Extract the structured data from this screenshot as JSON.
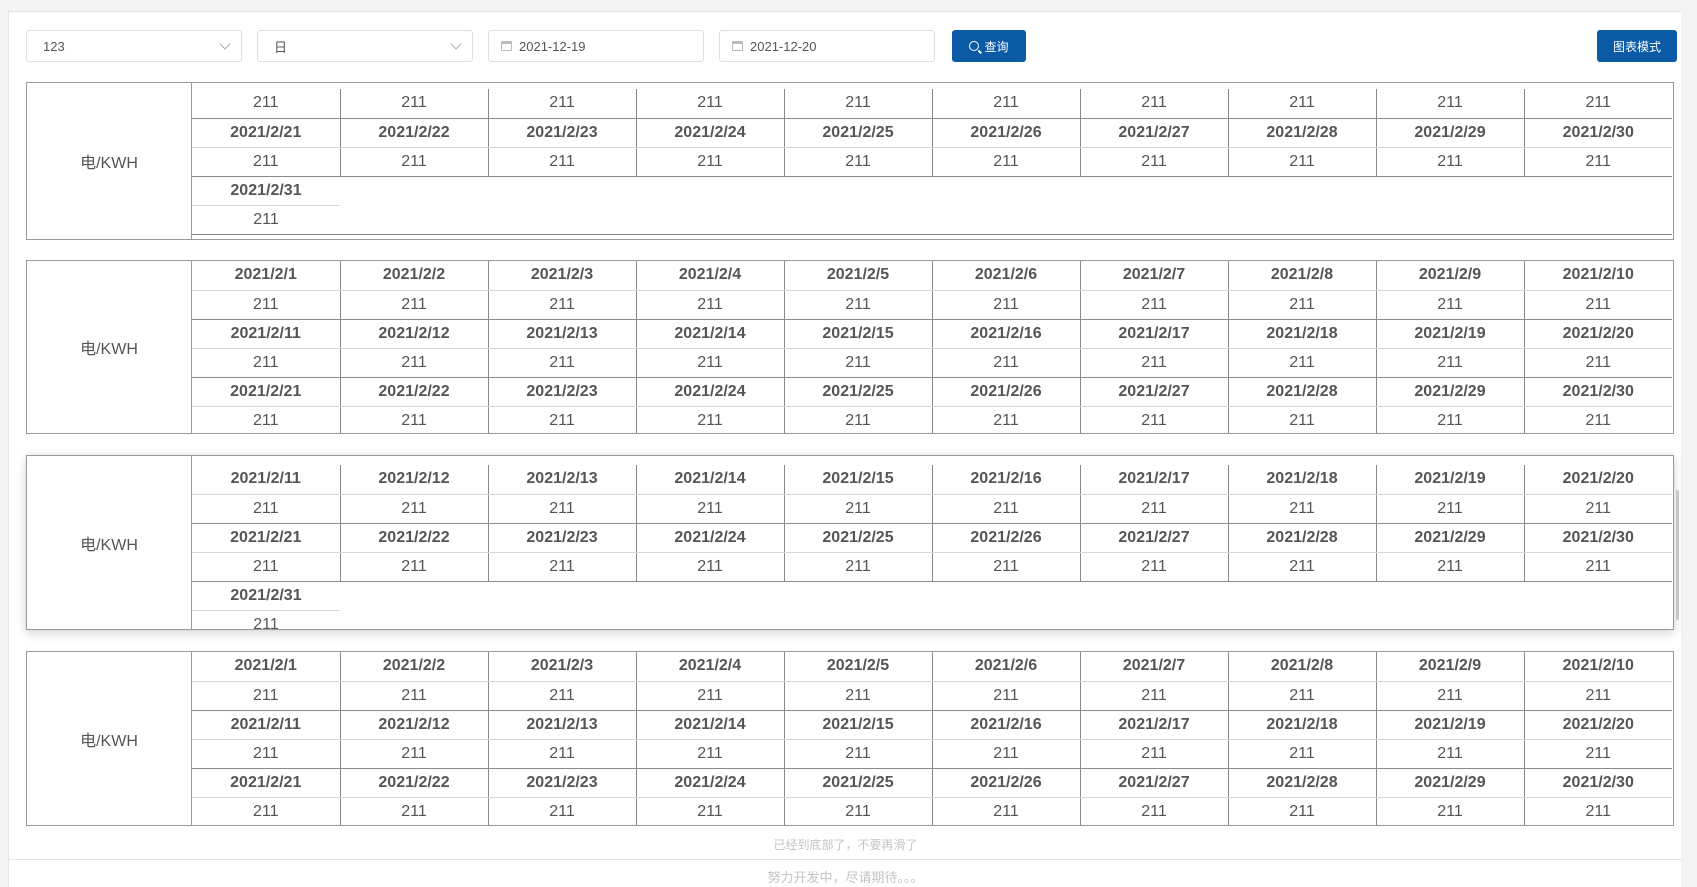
{
  "toolbar": {
    "device_select": "123",
    "period_select": "日",
    "start_date": "2021-12-19",
    "end_date": "2021-12-20",
    "query_label": "查询",
    "chart_mode_label": "图表模式"
  },
  "unit_label": "电/KWH",
  "blocks": [
    {
      "rows": [
        {
          "type": "v",
          "cells": [
            "211",
            "211",
            "211",
            "211",
            "211",
            "211",
            "211",
            "211",
            "211",
            "211"
          ]
        },
        {
          "type": "d",
          "cells": [
            "2021/2/21",
            "2021/2/22",
            "2021/2/23",
            "2021/2/24",
            "2021/2/25",
            "2021/2/26",
            "2021/2/27",
            "2021/2/28",
            "2021/2/29",
            "2021/2/30"
          ]
        },
        {
          "type": "v",
          "cells": [
            "211",
            "211",
            "211",
            "211",
            "211",
            "211",
            "211",
            "211",
            "211",
            "211"
          ]
        },
        {
          "type": "d",
          "cells": [
            "2021/2/31"
          ]
        },
        {
          "type": "v",
          "cells": [
            "211"
          ]
        }
      ]
    },
    {
      "rows": [
        {
          "type": "d",
          "cells": [
            "2021/2/1",
            "2021/2/2",
            "2021/2/3",
            "2021/2/4",
            "2021/2/5",
            "2021/2/6",
            "2021/2/7",
            "2021/2/8",
            "2021/2/9",
            "2021/2/10"
          ]
        },
        {
          "type": "v",
          "cells": [
            "211",
            "211",
            "211",
            "211",
            "211",
            "211",
            "211",
            "211",
            "211",
            "211"
          ]
        },
        {
          "type": "d",
          "cells": [
            "2021/2/11",
            "2021/2/12",
            "2021/2/13",
            "2021/2/14",
            "2021/2/15",
            "2021/2/16",
            "2021/2/17",
            "2021/2/18",
            "2021/2/19",
            "2021/2/20"
          ]
        },
        {
          "type": "v",
          "cells": [
            "211",
            "211",
            "211",
            "211",
            "211",
            "211",
            "211",
            "211",
            "211",
            "211"
          ]
        },
        {
          "type": "d",
          "cells": [
            "2021/2/21",
            "2021/2/22",
            "2021/2/23",
            "2021/2/24",
            "2021/2/25",
            "2021/2/26",
            "2021/2/27",
            "2021/2/28",
            "2021/2/29",
            "2021/2/30"
          ]
        },
        {
          "type": "v",
          "cells": [
            "211",
            "211",
            "211",
            "211",
            "211",
            "211",
            "211",
            "211",
            "211",
            "211"
          ]
        }
      ]
    },
    {
      "rows": [
        {
          "type": "d",
          "cells": [
            "2021/2/11",
            "2021/2/12",
            "2021/2/13",
            "2021/2/14",
            "2021/2/15",
            "2021/2/16",
            "2021/2/17",
            "2021/2/18",
            "2021/2/19",
            "2021/2/20"
          ]
        },
        {
          "type": "v",
          "cells": [
            "211",
            "211",
            "211",
            "211",
            "211",
            "211",
            "211",
            "211",
            "211",
            "211"
          ]
        },
        {
          "type": "d",
          "cells": [
            "2021/2/21",
            "2021/2/22",
            "2021/2/23",
            "2021/2/24",
            "2021/2/25",
            "2021/2/26",
            "2021/2/27",
            "2021/2/28",
            "2021/2/29",
            "2021/2/30"
          ]
        },
        {
          "type": "v",
          "cells": [
            "211",
            "211",
            "211",
            "211",
            "211",
            "211",
            "211",
            "211",
            "211",
            "211"
          ]
        },
        {
          "type": "d",
          "cells": [
            "2021/2/31"
          ]
        },
        {
          "type": "v",
          "cells": [
            "211"
          ]
        }
      ]
    },
    {
      "rows": [
        {
          "type": "d",
          "cells": [
            "2021/2/1",
            "2021/2/2",
            "2021/2/3",
            "2021/2/4",
            "2021/2/5",
            "2021/2/6",
            "2021/2/7",
            "2021/2/8",
            "2021/2/9",
            "2021/2/10"
          ]
        },
        {
          "type": "v",
          "cells": [
            "211",
            "211",
            "211",
            "211",
            "211",
            "211",
            "211",
            "211",
            "211",
            "211"
          ]
        },
        {
          "type": "d",
          "cells": [
            "2021/2/11",
            "2021/2/12",
            "2021/2/13",
            "2021/2/14",
            "2021/2/15",
            "2021/2/16",
            "2021/2/17",
            "2021/2/18",
            "2021/2/19",
            "2021/2/20"
          ]
        },
        {
          "type": "v",
          "cells": [
            "211",
            "211",
            "211",
            "211",
            "211",
            "211",
            "211",
            "211",
            "211",
            "211"
          ]
        },
        {
          "type": "d",
          "cells": [
            "2021/2/21",
            "2021/2/22",
            "2021/2/23",
            "2021/2/24",
            "2021/2/25",
            "2021/2/26",
            "2021/2/27",
            "2021/2/28",
            "2021/2/29",
            "2021/2/30"
          ]
        },
        {
          "type": "v",
          "cells": [
            "211",
            "211",
            "211",
            "211",
            "211",
            "211",
            "211",
            "211",
            "211",
            "211"
          ]
        }
      ]
    }
  ],
  "footer": {
    "bottom_notice": "已经到底部了，不要再滑了",
    "dev_notice": "努力开发中，尽请期待。。。"
  }
}
